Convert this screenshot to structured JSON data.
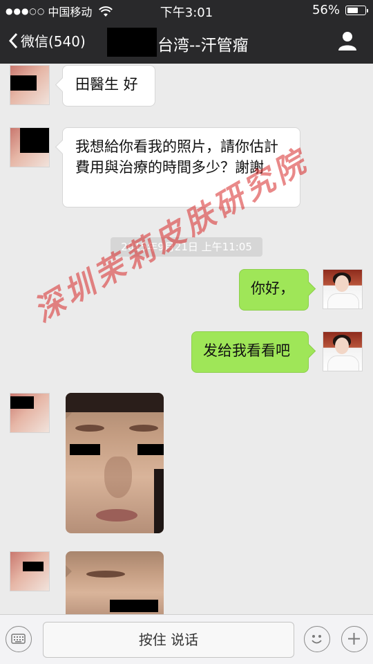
{
  "status_bar": {
    "signal": "●●●○○",
    "carrier": "中国移动",
    "time": "下午3:01",
    "battery_text": "56%",
    "battery_level": 0.56
  },
  "nav": {
    "back_label": "微信(540)",
    "title": "台湾--汗管瘤",
    "contact_icon": "person-icon"
  },
  "messages": [
    {
      "side": "in",
      "text": "田醫生 好"
    },
    {
      "side": "in",
      "text": "我想給你看我的照片，請你估計費用與治療的時間多少？謝謝"
    },
    {
      "side": "out",
      "text": "你好，"
    },
    {
      "side": "out",
      "text": "发给我看看吧"
    }
  ],
  "timestamp": "2015年9月21日 上午11:05",
  "watermark": "深圳茉莉皮肤研究院",
  "toolbar": {
    "keyboard_icon": "keyboard-icon",
    "talk_label": "按住 说话",
    "emoji_icon": "emoji-icon",
    "plus_icon": "plus-icon"
  },
  "colors": {
    "bar": "#29292b",
    "incoming": "#ffffff",
    "outgoing": "#9fe658",
    "background": "#ebebeb",
    "watermark": "#d72828"
  }
}
